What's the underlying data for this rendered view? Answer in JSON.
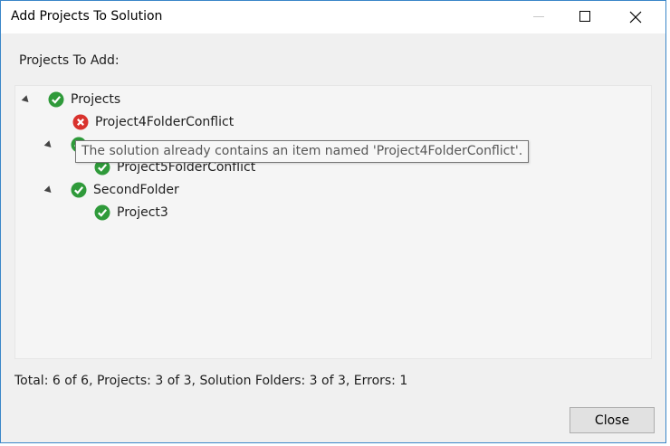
{
  "window": {
    "title": "Add Projects To Solution"
  },
  "dialog": {
    "section_label": "Projects To Add:",
    "tooltip": "The solution already contains an item named 'Project4FolderConflict'.",
    "summary": "Total: 6 of 6, Projects: 3 of 3, Solution Folders: 3 of 3, Errors: 1",
    "close_label": "Close"
  },
  "tree": {
    "root": {
      "label": "Projects",
      "status": "ok"
    },
    "project4": {
      "label": "Project4FolderConflict",
      "status": "error"
    },
    "project5": {
      "label": "Project5FolderConflict",
      "status": "ok"
    },
    "second_folder": {
      "label": "SecondFolder",
      "status": "ok"
    },
    "project3": {
      "label": "Project3",
      "status": "ok"
    }
  },
  "colors": {
    "ok": "#2f9a3a",
    "error": "#d9322d",
    "accent_border": "#3a86c8"
  },
  "icons": {
    "ok": "check-circle-icon",
    "error": "error-circle-icon"
  }
}
